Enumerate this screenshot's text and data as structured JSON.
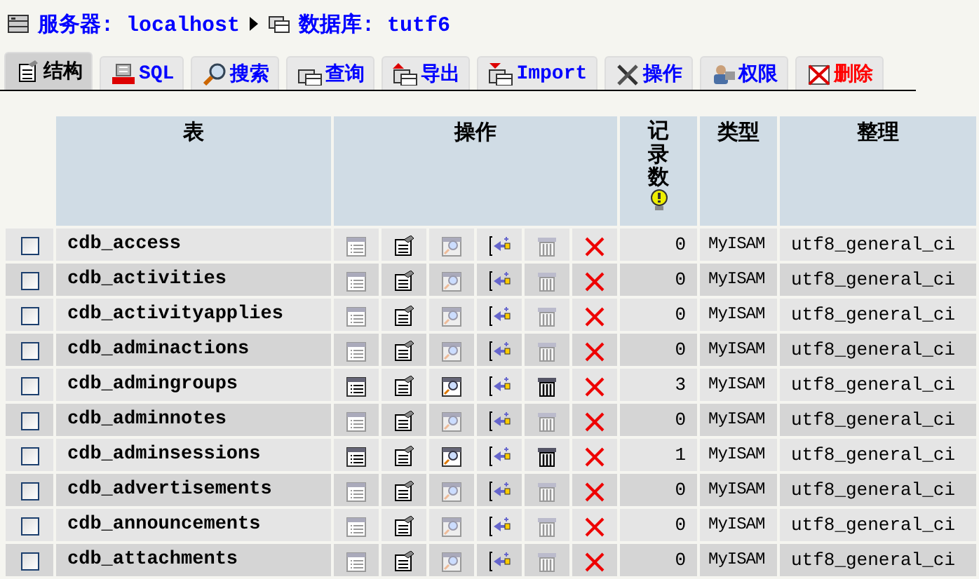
{
  "breadcrumb": {
    "server": "服务器: localhost",
    "database": "数据库: tutf6"
  },
  "tabs": [
    {
      "label": "结构",
      "selected": true,
      "danger": false
    },
    {
      "label": "SQL",
      "selected": false,
      "danger": false
    },
    {
      "label": "搜索",
      "selected": false,
      "danger": false
    },
    {
      "label": "查询",
      "selected": false,
      "danger": false
    },
    {
      "label": "导出",
      "selected": false,
      "danger": false
    },
    {
      "label": "Import",
      "selected": false,
      "danger": false
    },
    {
      "label": "操作",
      "selected": false,
      "danger": false
    },
    {
      "label": "权限",
      "selected": false,
      "danger": false
    },
    {
      "label": "删除",
      "selected": false,
      "danger": true
    }
  ],
  "table": {
    "columns": [
      "表",
      "操作",
      "记录数",
      "类型",
      "整理"
    ],
    "rows": [
      {
        "checked": false,
        "name": "cdb_access",
        "empty": true,
        "records": "0",
        "type": "MyISAM",
        "collation": "utf8_general_ci"
      },
      {
        "checked": false,
        "name": "cdb_activities",
        "empty": true,
        "records": "0",
        "type": "MyISAM",
        "collation": "utf8_general_ci"
      },
      {
        "checked": false,
        "name": "cdb_activityapplies",
        "empty": true,
        "records": "0",
        "type": "MyISAM",
        "collation": "utf8_general_ci"
      },
      {
        "checked": false,
        "name": "cdb_adminactions",
        "empty": true,
        "records": "0",
        "type": "MyISAM",
        "collation": "utf8_general_ci"
      },
      {
        "checked": false,
        "name": "cdb_admingroups",
        "empty": false,
        "records": "3",
        "type": "MyISAM",
        "collation": "utf8_general_ci"
      },
      {
        "checked": false,
        "name": "cdb_adminnotes",
        "empty": true,
        "records": "0",
        "type": "MyISAM",
        "collation": "utf8_general_ci"
      },
      {
        "checked": false,
        "name": "cdb_adminsessions",
        "empty": false,
        "records": "1",
        "type": "MyISAM",
        "collation": "utf8_general_ci"
      },
      {
        "checked": false,
        "name": "cdb_advertisements",
        "empty": true,
        "records": "0",
        "type": "MyISAM",
        "collation": "utf8_general_ci"
      },
      {
        "checked": false,
        "name": "cdb_announcements",
        "empty": true,
        "records": "0",
        "type": "MyISAM",
        "collation": "utf8_general_ci"
      },
      {
        "checked": false,
        "name": "cdb_attachments",
        "empty": true,
        "records": "0",
        "type": "MyISAM",
        "collation": "utf8_general_ci"
      }
    ]
  }
}
